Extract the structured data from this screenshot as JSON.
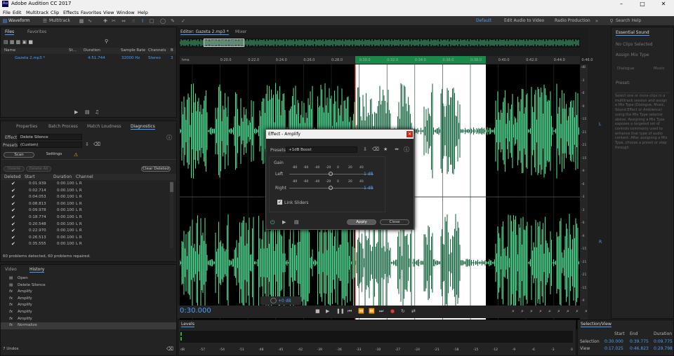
{
  "app": {
    "title": "Adobe Audition CC 2017",
    "icon": "Au"
  },
  "menu": [
    "File",
    "Edit",
    "Multitrack",
    "Clip",
    "Effects",
    "Favorites",
    "View",
    "Window",
    "Help"
  ],
  "toolbar": {
    "waveform": "Waveform",
    "multitrack": "Multitrack",
    "workspaces": [
      "Default",
      "Edit Audio to Video",
      "Radio Production"
    ],
    "search_placeholder": "Search Help"
  },
  "files": {
    "tabs": [
      "Files",
      "Favorites"
    ],
    "columns": [
      "Name",
      "St...",
      "Duration",
      "Sample Rate",
      "Channels",
      "B"
    ],
    "row": {
      "name": "Gazeta 2.mp3 *",
      "duration": "4:51.744",
      "rate": "32000 Hz",
      "channels": "Stereo",
      "b": "3"
    }
  },
  "diag": {
    "tabs": [
      "Properties",
      "Batch Process",
      "Match Loudness",
      "Diagnostics"
    ],
    "effect_label": "Effect:",
    "effect": "Delete Silence",
    "presets_label": "Presets:",
    "preset": "(Custom)",
    "scan": "Scan",
    "settings": "Settings",
    "delete": "Delete",
    "delete_all": "Delete All",
    "clear_deleted": "Clear Deleted",
    "columns": [
      "Deleted",
      "Start",
      "Duration",
      "Channel"
    ],
    "rows": [
      [
        "0:01.939",
        "0:00.100",
        "L R"
      ],
      [
        "0:02.714",
        "0:00.100",
        "L R"
      ],
      [
        "0:04.053",
        "0:00.100",
        "L R"
      ],
      [
        "0:08.813",
        "0:00.100",
        "L R"
      ],
      [
        "0:09.978",
        "0:00.100",
        "L R"
      ],
      [
        "0:18.774",
        "0:00.100",
        "L R"
      ],
      [
        "0:20.548",
        "0:00.100",
        "L R"
      ],
      [
        "0:22.970",
        "0:00.100",
        "L R"
      ],
      [
        "0:26.513",
        "0:00.100",
        "L R"
      ],
      [
        "0:35.555",
        "0:00.100",
        "L R"
      ]
    ],
    "status": "60 problems detected, 60 problems repaired."
  },
  "history": {
    "tabs": [
      "Video",
      "History"
    ],
    "items": [
      "Open",
      "Delete Silence",
      "Amplify",
      "Amplify",
      "Amplify",
      "Amplify",
      "Amplify",
      "Normalize"
    ],
    "undos": "7 Undos"
  },
  "editor": {
    "tab": "Editor: Gazeta 2.mp3 *",
    "mixer": "Mixer",
    "ruler": [
      "hms",
      "0:20.0",
      "0:22.0",
      "0:24.0",
      "0:26.0",
      "0:28.0",
      "0:30.0",
      "0:32.0",
      "0:34.0",
      "0:36.0",
      "0:38.0",
      "0:40.0",
      "0:42.0",
      "0:44.0",
      "0:46.0"
    ],
    "db": [
      "dB",
      "-3",
      "-6",
      "-9",
      "-15",
      "-21",
      "-21",
      "-15",
      "-9",
      "-6",
      "-3",
      "-3",
      "-6",
      "-9",
      "-15",
      "-21",
      "-21",
      "-15",
      "-9",
      "-6",
      "-3"
    ],
    "ch_l": "L",
    "ch_r": "R",
    "gain": "+0 dB",
    "time": "0:30.000"
  },
  "amplify": {
    "title": "Effect - Amplify",
    "presets_label": "Presets:",
    "preset": "+1dB Boost",
    "gain": "Gain",
    "left": "Left",
    "right": "Right",
    "ticks": [
      "-80",
      "-60",
      "-40",
      "-20",
      "0",
      "20",
      "40"
    ],
    "left_val": "1 dB",
    "right_val": "1 dB",
    "link": "Link Sliders",
    "apply": "Apply",
    "close": "Close"
  },
  "essential": {
    "title": "Essential Sound",
    "no_clips": "No Clips Selected",
    "assign": "Assign Mix Type",
    "dialogue": "Dialogue",
    "music": "Music",
    "preset_label": "Preset:",
    "help": "Select one or more clips in a multitrack session and assign a Mix Type (Dialogue, Music, Sound Effect or Ambience) using the Mix Type selector above. Assigning a Mix Type exposes a targeted set of controls commonly used to enhance that type of audio content. After assigning a Mix Type, choose a preset or step through"
  },
  "levels": {
    "title": "Levels",
    "scale": [
      "dB",
      "-57",
      "-54",
      "-51",
      "-48",
      "-45",
      "-42",
      "-39",
      "-36",
      "-33",
      "-30",
      "-27",
      "-24",
      "-21",
      "-18",
      "-15",
      "-12",
      "-9",
      "-6",
      "-3",
      "0"
    ]
  },
  "selview": {
    "title": "Selection/View",
    "cols": [
      "Start",
      "End",
      "Duration"
    ],
    "selection": [
      "0:30.000",
      "0:39.775",
      "0:09.775"
    ],
    "view": [
      "0:17.025",
      "0:46.823",
      "0:29.798"
    ],
    "sel_label": "Selection",
    "view_label": "View"
  },
  "colors": {
    "accent": "#4a9eff",
    "wave": "#4fd58f",
    "playhead": "#e53935"
  }
}
